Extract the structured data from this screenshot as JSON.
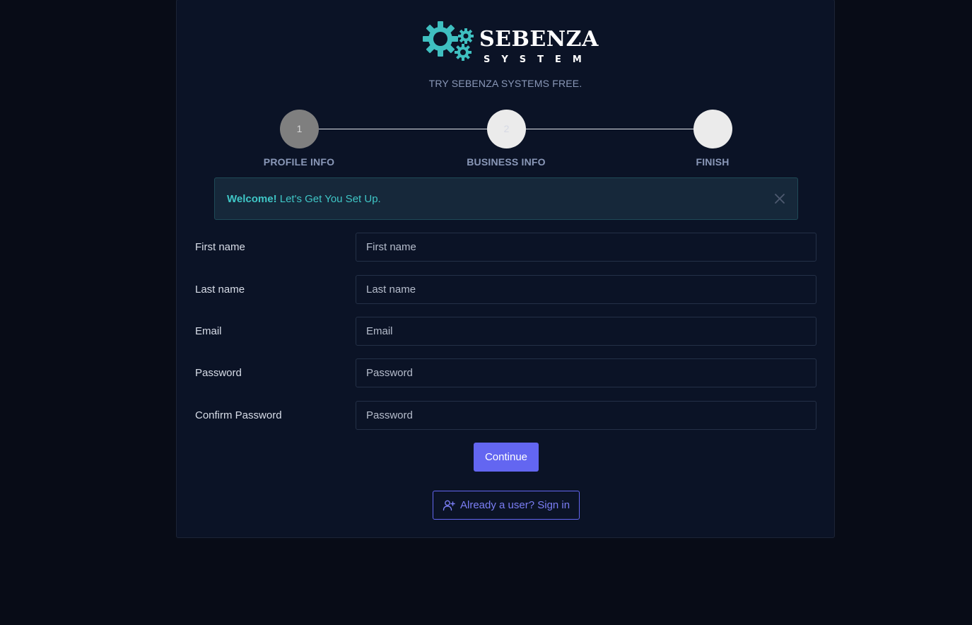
{
  "brand": {
    "name": "SEBENZA",
    "sub": "SYSTEM",
    "tagline": "TRY SEBENZA SYSTEMS FREE.",
    "accent_color": "#3fbfc0"
  },
  "steps": [
    {
      "number": "1",
      "label": "PROFILE INFO",
      "state": "active"
    },
    {
      "number": "2",
      "label": "BUSINESS INFO",
      "state": "pending"
    },
    {
      "number": "",
      "label": "FINISH",
      "state": "pending"
    }
  ],
  "alert": {
    "strong": "Welcome!",
    "message": " Let's Get You Set Up.",
    "close_icon": "close-icon"
  },
  "form": {
    "first_name": {
      "label": "First name",
      "placeholder": "First name"
    },
    "last_name": {
      "label": "Last name",
      "placeholder": "Last name"
    },
    "email": {
      "label": "Email",
      "placeholder": "Email"
    },
    "password": {
      "label": "Password",
      "placeholder": "Password"
    },
    "confirm_password": {
      "label": "Confirm Password",
      "placeholder": "Password"
    }
  },
  "actions": {
    "continue_label": "Continue",
    "signin_label": "Already a user? Sign in",
    "signin_icon": "user-plus-icon",
    "primary_color": "#6366f1"
  }
}
